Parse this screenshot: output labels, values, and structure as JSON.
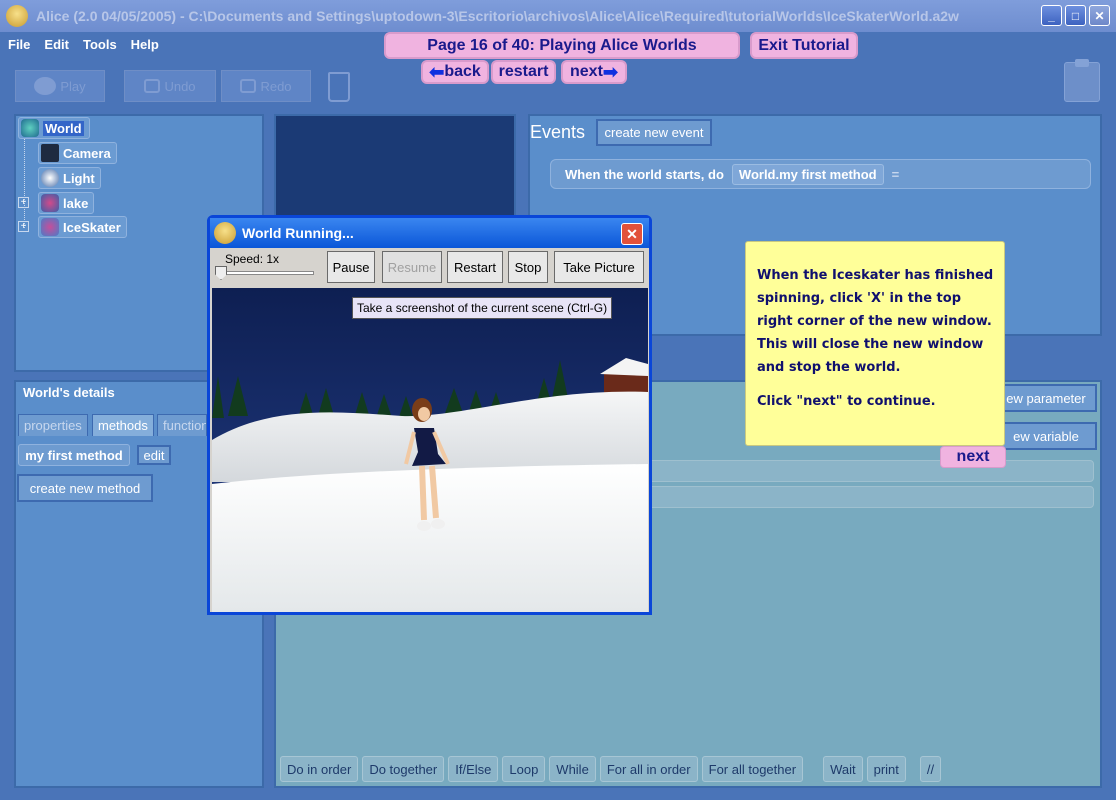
{
  "window": {
    "title": "Alice (2.0 04/05/2005) - C:\\Documents and Settings\\uptodown-3\\Escritorio\\archivos\\Alice\\Alice\\Required\\tutorialWorlds\\IceSkaterWorld.a2w",
    "minimize": "_",
    "maximize": "□",
    "close": "✕"
  },
  "menu": [
    "File",
    "Edit",
    "Tools",
    "Help"
  ],
  "tutorial": {
    "page_label": "Page 16 of 40: Playing Alice Worlds",
    "exit_label": "Exit Tutorial",
    "back_label": "back",
    "restart_label": "restart",
    "next_label": "next",
    "note_p1": "When the Iceskater has finished spinning, click 'X' in the top right corner of the new window. This will close the new window and stop the world.",
    "note_p2": "Click \"next\" to continue.",
    "note_next": "next"
  },
  "toolbar": {
    "play_label": "Play",
    "undo_label": "Undo",
    "redo_label": "Redo"
  },
  "object_tree": {
    "items": [
      {
        "label": "World"
      },
      {
        "label": "Camera"
      },
      {
        "label": "Light"
      },
      {
        "label": "lake"
      },
      {
        "label": "IceSkater"
      }
    ]
  },
  "events": {
    "title": "Events",
    "create_new_event": "create new event",
    "event_when": "When the world starts,  do",
    "event_method": "World.my first method",
    "event_menu": "="
  },
  "details": {
    "title": "World's details",
    "tabs": [
      "properties",
      "methods",
      "functions"
    ],
    "method_name": "my first method",
    "edit_label": "edit",
    "create_new_method": "create new method"
  },
  "editor": {
    "new_parameter": "ew parameter",
    "new_variable": "ew variable"
  },
  "codebar": [
    "Do in order",
    "Do together",
    "If/Else",
    "Loop",
    "While",
    "For all in order",
    "For all together",
    "Wait",
    "print",
    "//"
  ],
  "world_running": {
    "title": "World Running...",
    "close": "✕",
    "speed_label": "Speed: 1x",
    "speed": 1,
    "pause": "Pause",
    "resume": "Resume",
    "restart": "Restart",
    "stop": "Stop",
    "take_picture": "Take Picture",
    "tooltip": "Take a screenshot of the current scene (Ctrl-G)"
  }
}
